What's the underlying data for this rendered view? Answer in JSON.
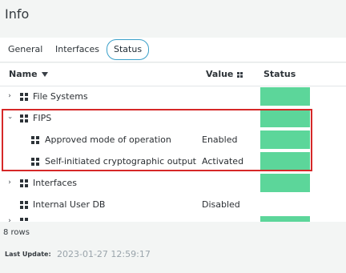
{
  "page": {
    "title": "Info"
  },
  "tabs": [
    {
      "label": "General"
    },
    {
      "label": "Interfaces"
    },
    {
      "label": "Status",
      "active": true
    }
  ],
  "table": {
    "columns": {
      "name": "Name",
      "value": "Value",
      "status": "Status"
    },
    "rows": [
      {
        "label": "File Systems",
        "value": "",
        "expandable": true,
        "expanded": false,
        "status_color": "#5cd69a"
      },
      {
        "label": "FIPS",
        "value": "",
        "expandable": true,
        "expanded": true,
        "status_color": "#5cd69a"
      },
      {
        "label": "Approved mode of operation",
        "value": "Enabled",
        "status_color": "#5cd69a"
      },
      {
        "label": "Self-initiated cryptographic output",
        "value": "Activated",
        "status_color": "#5cd69a"
      },
      {
        "label": "Interfaces",
        "value": "",
        "expandable": true,
        "expanded": false,
        "status_color": "#5cd69a"
      },
      {
        "label": "Internal User DB",
        "value": "Disabled",
        "status_color": ""
      }
    ]
  },
  "footer": {
    "rows_count": "8 rows",
    "last_update_label": "Last Update:",
    "last_update_value": "2023-01-27 12:59:17"
  },
  "colors": {
    "status_ok": "#5cd69a",
    "highlight": "#d62828",
    "active_tab_border": "#3aa0c9"
  }
}
